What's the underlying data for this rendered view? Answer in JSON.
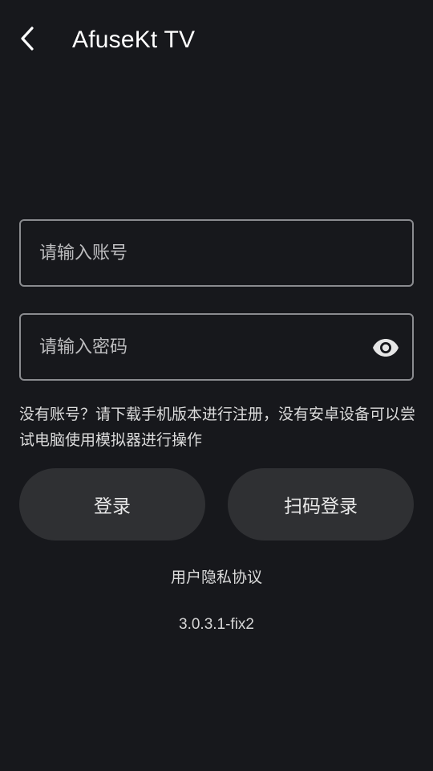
{
  "header": {
    "title": "AfuseKt TV",
    "back_icon": "chevron-left-icon"
  },
  "form": {
    "account_placeholder": "请输入账号",
    "account_value": "",
    "password_placeholder": "请输入密码",
    "password_value": "",
    "visibility_icon": "eye-icon"
  },
  "hint_text": "没有账号？请下载手机版本进行注册，没有安卓设备可以尝试电脑使用模拟器进行操作",
  "buttons": {
    "login_label": "登录",
    "scan_login_label": "扫码登录"
  },
  "privacy_label": "用户隐私协议",
  "version": "3.0.3.1-fix2",
  "colors": {
    "background": "#17181c",
    "button_bg": "#2f3033",
    "border": "#8a8b8f"
  }
}
